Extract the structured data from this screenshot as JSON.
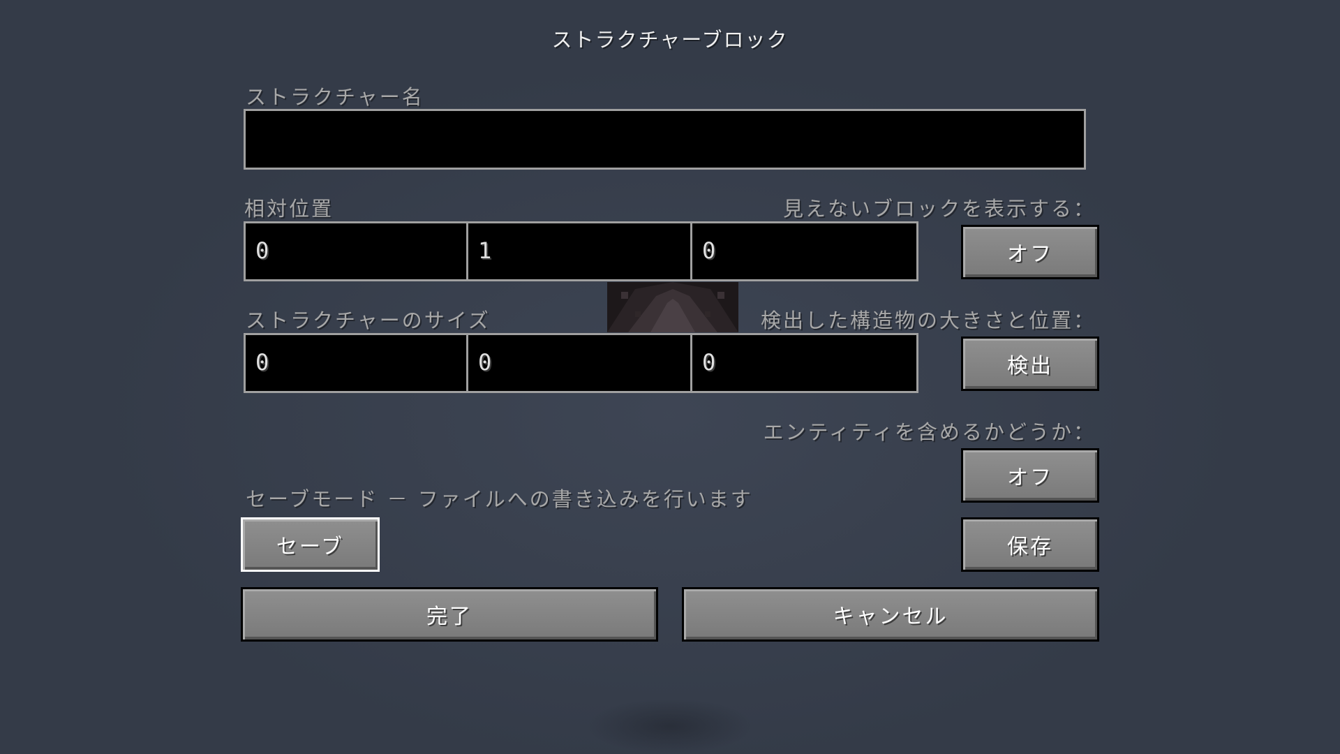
{
  "title": "ストラクチャーブロック",
  "structure_name": {
    "label": "ストラクチャー名",
    "value": ""
  },
  "relative_position": {
    "label": "相対位置",
    "x": "0",
    "y": "1",
    "z": "0"
  },
  "show_invisible": {
    "label": "見えないブロックを表示する：",
    "button": "オフ"
  },
  "structure_size": {
    "label": "ストラクチャーのサイズ",
    "x": "0",
    "y": "0",
    "z": "0"
  },
  "detect": {
    "label": "検出した構造物の大きさと位置：",
    "button": "検出"
  },
  "include_entities": {
    "label": "エンティティを含めるかどうか：",
    "button": "オフ"
  },
  "mode": {
    "label": "セーブモード － ファイルへの書き込みを行います",
    "button": "セーブ"
  },
  "save_button": "保存",
  "done_button": "完了",
  "cancel_button": "キャンセル"
}
